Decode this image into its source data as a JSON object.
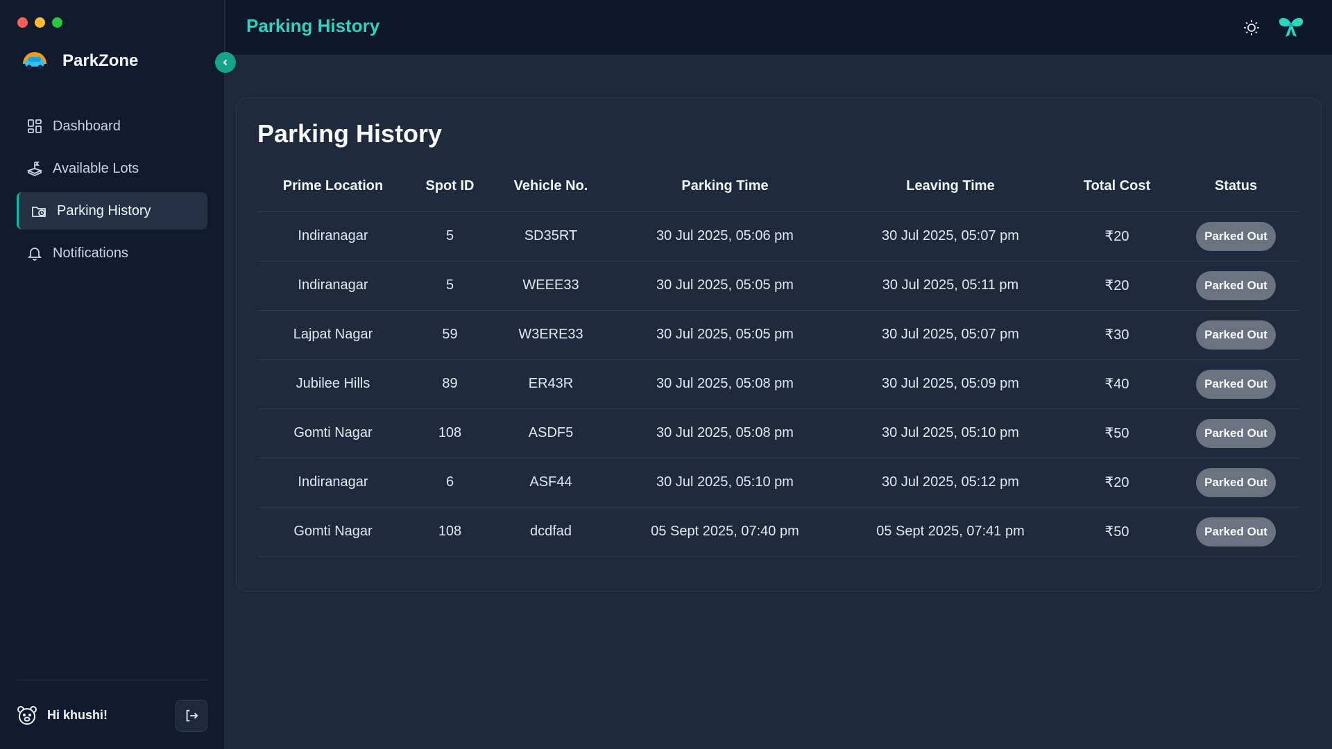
{
  "app": {
    "name": "ParkZone"
  },
  "sidebar": {
    "items": [
      {
        "label": "Dashboard",
        "icon": "dashboard-icon"
      },
      {
        "label": "Available Lots",
        "icon": "parking-lot-icon"
      },
      {
        "label": "Parking History",
        "icon": "history-icon",
        "active": true
      },
      {
        "label": "Notifications",
        "icon": "bell-icon"
      }
    ],
    "greeting": "Hi khushi!"
  },
  "header": {
    "title": "Parking History"
  },
  "main": {
    "title": "Parking History",
    "columns": [
      "Prime Location",
      "Spot ID",
      "Vehicle No.",
      "Parking Time",
      "Leaving Time",
      "Total Cost",
      "Status"
    ],
    "rows": [
      {
        "location": "Indiranagar",
        "spot": "5",
        "vehicle": "SD35RT",
        "parking": "30 Jul 2025, 05:06 pm",
        "leaving": "30 Jul 2025, 05:07 pm",
        "cost": "₹20",
        "status": "Parked Out"
      },
      {
        "location": "Indiranagar",
        "spot": "5",
        "vehicle": "WEEE33",
        "parking": "30 Jul 2025, 05:05 pm",
        "leaving": "30 Jul 2025, 05:11 pm",
        "cost": "₹20",
        "status": "Parked Out"
      },
      {
        "location": "Lajpat Nagar",
        "spot": "59",
        "vehicle": "W3ERE33",
        "parking": "30 Jul 2025, 05:05 pm",
        "leaving": "30 Jul 2025, 05:07 pm",
        "cost": "₹30",
        "status": "Parked Out"
      },
      {
        "location": "Jubilee Hills",
        "spot": "89",
        "vehicle": "ER43R",
        "parking": "30 Jul 2025, 05:08 pm",
        "leaving": "30 Jul 2025, 05:09 pm",
        "cost": "₹40",
        "status": "Parked Out"
      },
      {
        "location": "Gomti Nagar",
        "spot": "108",
        "vehicle": "ASDF5",
        "parking": "30 Jul 2025, 05:08 pm",
        "leaving": "30 Jul 2025, 05:10 pm",
        "cost": "₹50",
        "status": "Parked Out"
      },
      {
        "location": "Indiranagar",
        "spot": "6",
        "vehicle": "ASF44",
        "parking": "30 Jul 2025, 05:10 pm",
        "leaving": "30 Jul 2025, 05:12 pm",
        "cost": "₹20",
        "status": "Parked Out"
      },
      {
        "location": "Gomti Nagar",
        "spot": "108",
        "vehicle": "dcdfad",
        "parking": "05 Sept 2025, 07:40 pm",
        "leaving": "05 Sept 2025, 07:41 pm",
        "cost": "₹50",
        "status": "Parked Out"
      }
    ]
  },
  "colors": {
    "accent": "#2dd4bf",
    "sidebar_bg": "#111a2e",
    "page_bg": "#1e293b",
    "badge_bg": "#6b7280"
  }
}
